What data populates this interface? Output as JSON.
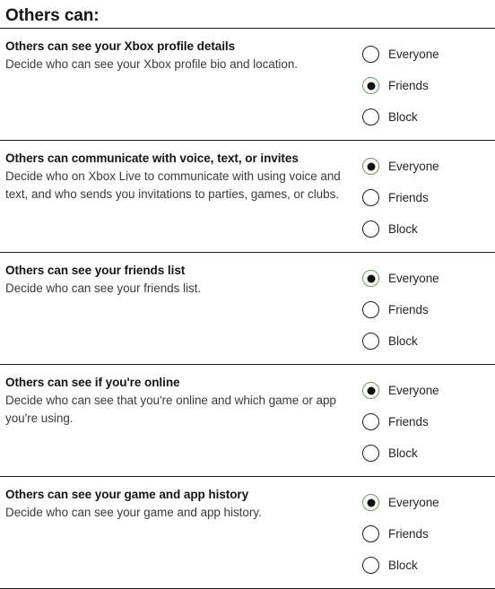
{
  "header": {
    "title": "Others can:"
  },
  "radio_options": [
    "Everyone",
    "Friends",
    "Block"
  ],
  "colors": {
    "selected_ring": "#6a9b5f",
    "selected_dot": "#111111",
    "unselected_ring": "#1d1d1d",
    "divider": "#1a1a1a",
    "title_text": "#151515",
    "description_text": "#3b3b3b",
    "background": "#ffffff"
  },
  "settings": [
    {
      "title": "Others can see your Xbox profile details",
      "description": "Decide who can see your Xbox profile bio and location.",
      "options": [
        {
          "label": "Everyone",
          "selected": false
        },
        {
          "label": "Friends",
          "selected": true
        },
        {
          "label": "Block",
          "selected": false
        }
      ]
    },
    {
      "title": "Others can communicate with voice, text, or invites",
      "description": "Decide who on Xbox Live to communicate with using voice and text, and who sends you invitations to parties, games, or clubs.",
      "options": [
        {
          "label": "Everyone",
          "selected": true
        },
        {
          "label": "Friends",
          "selected": false
        },
        {
          "label": "Block",
          "selected": false
        }
      ]
    },
    {
      "title": "Others can see your friends list",
      "description": "Decide who can see your friends list.",
      "options": [
        {
          "label": "Everyone",
          "selected": true
        },
        {
          "label": "Friends",
          "selected": false
        },
        {
          "label": "Block",
          "selected": false
        }
      ]
    },
    {
      "title": "Others can see if you're online",
      "description": "Decide who can see that you're online and which game or app you're using.",
      "options": [
        {
          "label": "Everyone",
          "selected": true
        },
        {
          "label": "Friends",
          "selected": false
        },
        {
          "label": "Block",
          "selected": false
        }
      ]
    },
    {
      "title": "Others can see your game and app history",
      "description": "Decide who can see your game and app history.",
      "options": [
        {
          "label": "Everyone",
          "selected": true
        },
        {
          "label": "Friends",
          "selected": false
        },
        {
          "label": "Block",
          "selected": false
        }
      ]
    }
  ]
}
